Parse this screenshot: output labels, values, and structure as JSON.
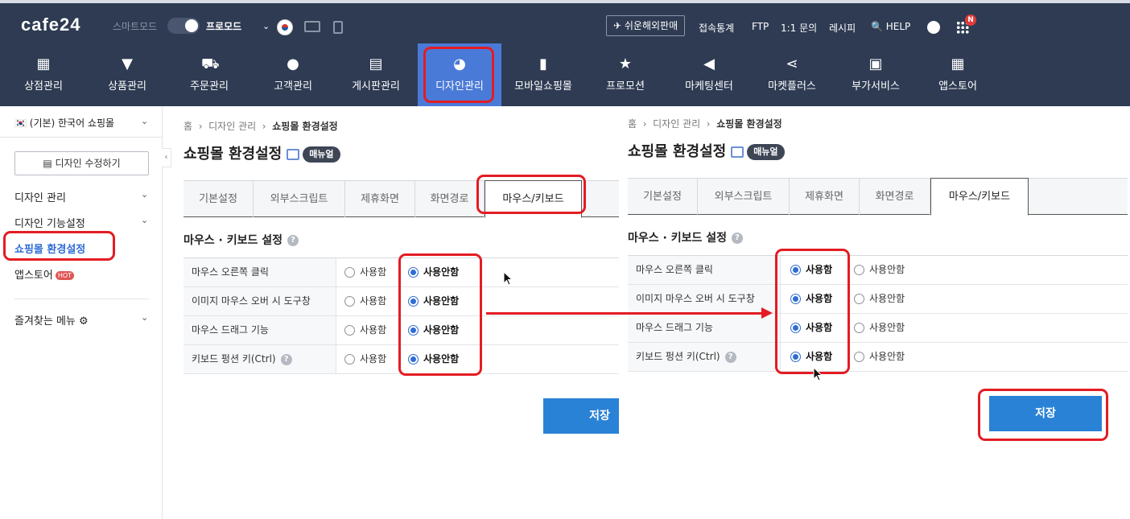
{
  "topbar": {
    "logo": "cafe24",
    "smart_mode": "스마트모드",
    "pro_mode": "프로모드",
    "caret": "⌄",
    "global_sale": "✈ 쉬운해외판매",
    "links": [
      "접속통계",
      "FTP",
      "1:1 문의",
      "레시피",
      "🔍 HELP"
    ],
    "badge": "N"
  },
  "nav": [
    {
      "label": "상점관리",
      "icon": "store-icon",
      "glyph": "▦"
    },
    {
      "label": "상품관리",
      "icon": "shirt-icon",
      "glyph": "▼"
    },
    {
      "label": "주문관리",
      "icon": "cart-icon",
      "glyph": "⛟"
    },
    {
      "label": "고객관리",
      "icon": "user-icon",
      "glyph": "●"
    },
    {
      "label": "게시판관리",
      "icon": "board-icon",
      "glyph": "▤"
    },
    {
      "label": "디자인관리",
      "icon": "palette-icon",
      "glyph": "◕"
    },
    {
      "label": "모바일쇼핑몰",
      "icon": "mobile-icon",
      "glyph": "▮"
    },
    {
      "label": "프로모션",
      "icon": "star-icon",
      "glyph": "★"
    },
    {
      "label": "마케팅센터",
      "icon": "megaphone-icon",
      "glyph": "◀"
    },
    {
      "label": "마켓플러스",
      "icon": "share-icon",
      "glyph": "⋖"
    },
    {
      "label": "부가서비스",
      "icon": "folder-plus-icon",
      "glyph": "▣"
    },
    {
      "label": "앱스토어",
      "icon": "apps-grid-icon",
      "glyph": "▦"
    }
  ],
  "sidebar": {
    "mall": "🇰🇷 (기본) 한국어 쇼핑몰",
    "design_edit": "▤ 디자인 수정하기",
    "items": [
      "디자인 관리",
      "디자인 기능설정",
      "쇼핑몰 환경설정",
      "앱스토어"
    ],
    "hot": "HOT",
    "favorites": "즐겨찾는 메뉴 ⚙"
  },
  "breadcrumb": {
    "home": "홈",
    "sep": "›",
    "level1": "디자인 관리",
    "current": "쇼핑몰 환경설정"
  },
  "page_title": "쇼핑몰 환경설정",
  "manual": "매뉴얼",
  "tabs": [
    "기본설정",
    "외부스크립트",
    "제휴화면",
    "화면경로",
    "마우스/키보드"
  ],
  "section_title": "마우스 · 키보드 설정",
  "help": "?",
  "settings_rows": [
    "마우스 오른쪽 클릭",
    "이미지 마우스 오버 시 도구창",
    "마우스 드래그 기능",
    "키보드 펑션 키(Ctrl)"
  ],
  "option_use": "사용함",
  "option_nouse": "사용안함",
  "save": "저장",
  "before": {
    "selected": [
      "nouse",
      "nouse",
      "nouse",
      "nouse"
    ]
  },
  "after": {
    "selected": [
      "use",
      "use",
      "use",
      "use"
    ]
  },
  "colors": {
    "nav_bg": "#2e3b53",
    "active_nav": "#4a7ad8",
    "highlight": "#e31c23",
    "save_btn": "#2a82d6"
  }
}
